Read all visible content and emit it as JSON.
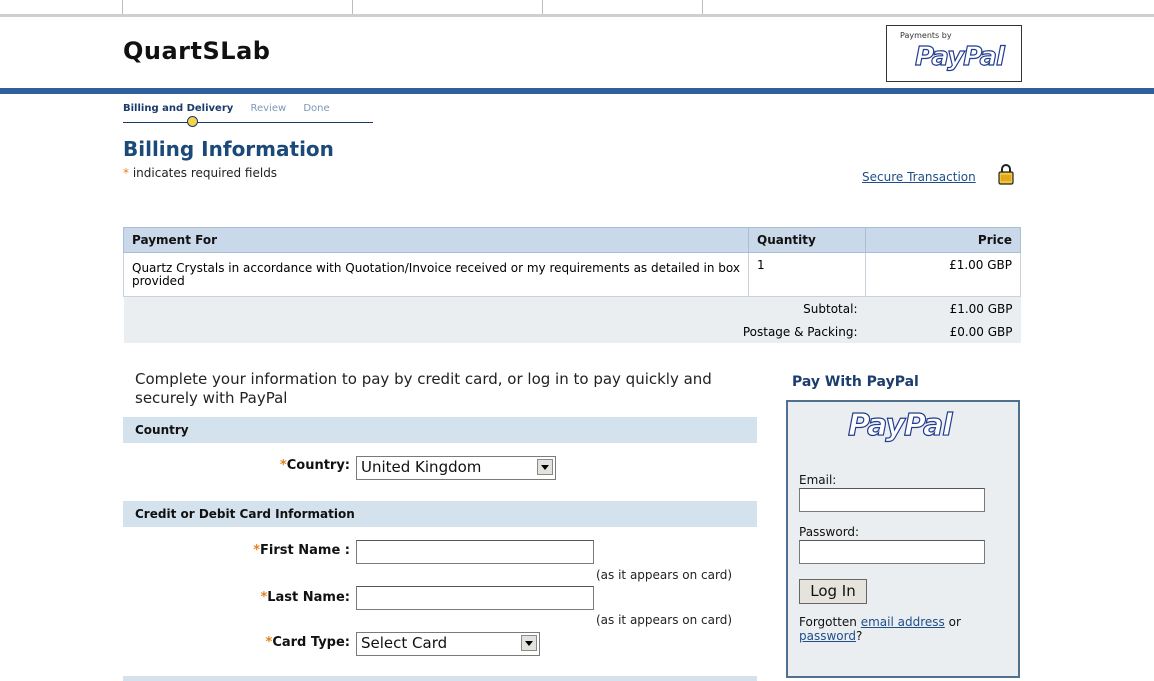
{
  "header": {
    "brand": "QuartSLab",
    "paypal_badge_small": "Payments by",
    "paypal_logo": "PayPal"
  },
  "steps": [
    "Billing and Delivery",
    "Review",
    "Done"
  ],
  "page_title": "Billing Information",
  "required_note": "indicates required fields",
  "required_star": "*",
  "secure_link": "Secure Transaction",
  "order": {
    "headers": {
      "payment_for": "Payment For",
      "quantity": "Quantity",
      "price": "Price"
    },
    "item": {
      "description": "Quartz Crystals in accordance with Quotation/Invoice received or my requirements as detailed in box provided",
      "quantity": "1",
      "price": "£1.00 GBP"
    },
    "subtotal_label": "Subtotal:",
    "subtotal_value": "£1.00 GBP",
    "postage_label": "Postage & Packing:",
    "postage_value": "£0.00 GBP"
  },
  "info_text": "Complete your information to pay by credit card, or log in to pay quickly and securely with PayPal",
  "country_section": {
    "header": "Country",
    "label": "Country:",
    "selected": "United Kingdom"
  },
  "card_section": {
    "header": "Credit or Debit Card Information",
    "first_name_label": "First Name :",
    "last_name_label": "Last Name:",
    "card_type_label": "Card Type:",
    "card_type_selected": "Select Card",
    "as_on_card": "(as it appears on card)"
  },
  "paypal_login": {
    "title": "Pay With PayPal",
    "logo": "PayPal",
    "email_label": "Email:",
    "password_label": "Password:",
    "login_button": "Log In",
    "forgot_prefix": "Forgotten",
    "forgot_email_link": "email address",
    "forgot_or": "or",
    "forgot_password_link": "password",
    "forgot_suffix": "?"
  },
  "colors": {
    "header_bar": "#30609b",
    "section_bg": "#d4e2ee",
    "title_blue": "#1c4a78",
    "required_star": "#e8801a",
    "link_blue": "#1e4f8a"
  }
}
